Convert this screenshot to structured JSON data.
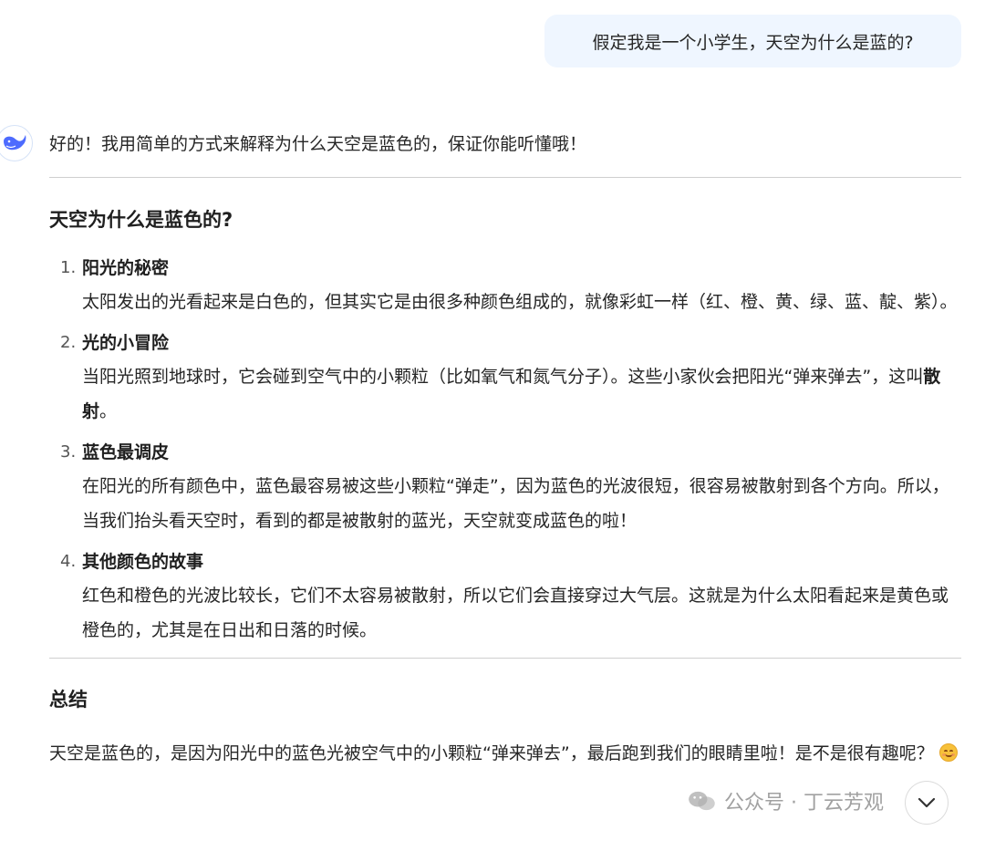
{
  "conversation": {
    "user_message": "假定我是一个小学生，天空为什么是蓝的?",
    "assistant": {
      "avatar_icon": "whale-logo-icon",
      "intro": "好的！我用简单的方式来解释为什么天空是蓝色的，保证你能听懂哦！",
      "section_title": "天空为什么是蓝色的?",
      "items": [
        {
          "number": "1.",
          "title": "阳光的秘密",
          "body": "太阳发出的光看起来是白色的，但其实它是由很多种颜色组成的，就像彩虹一样（红、橙、黄、绿、蓝、靛、紫）。"
        },
        {
          "number": "2.",
          "title": "光的小冒险",
          "body_before": "当阳光照到地球时，它会碰到空气中的小颗粒（比如氧气和氮气分子）。这些小家伙会把阳光“弹来弹去”，这叫",
          "body_bold": "散射",
          "body_after": "。"
        },
        {
          "number": "3.",
          "title": "蓝色最调皮",
          "body": "在阳光的所有颜色中，蓝色最容易被这些小颗粒“弹走”，因为蓝色的光波很短，很容易被散射到各个方向。所以，当我们抬头看天空时，看到的都是被散射的蓝光，天空就变成蓝色的啦！"
        },
        {
          "number": "4.",
          "title": "其他颜色的故事",
          "body": "红色和橙色的光波比较长，它们不太容易被散射，所以它们会直接穿过大气层。这就是为什么太阳看起来是黄色或橙色的，尤其是在日出和日落的时候。"
        }
      ],
      "summary_title": "总结",
      "summary": "天空是蓝色的，是因为阳光中的蓝色光被空气中的小颗粒“弹来弹去”，最后跑到我们的眼睛里啦！是不是很有趣呢？",
      "summary_emoji": "smiling-face-emoji"
    }
  },
  "watermark": {
    "text": "公众号 · 丁云芳观"
  },
  "scroll_button": {
    "icon": "chevron-down-icon"
  },
  "colors": {
    "user_bubble_bg": "#eff6ff",
    "brand_blue": "#4d6bfe",
    "divider": "#cfcfcf",
    "text": "#262626"
  }
}
